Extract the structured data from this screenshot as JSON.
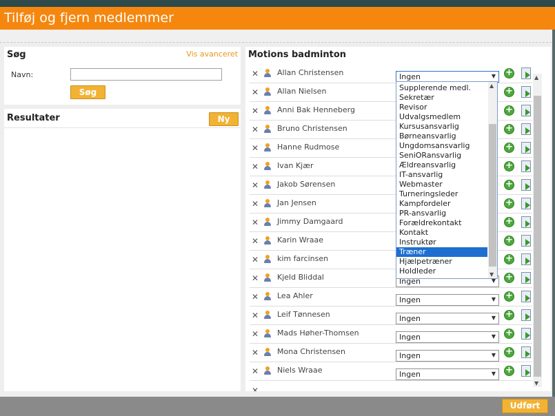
{
  "window": {
    "title": "Tilføj og fjern medlemmer"
  },
  "search": {
    "heading": "Søg",
    "advanced_link": "Vis avanceret",
    "name_label": "Navn:",
    "name_value": "",
    "search_button": "Søg"
  },
  "results": {
    "heading": "Resultater",
    "new_button": "Ny"
  },
  "group": {
    "heading": "Motions badminton"
  },
  "members": [
    {
      "name": "Allan Christensen",
      "role": "Ingen"
    },
    {
      "name": "Allan Nielsen",
      "role": ""
    },
    {
      "name": "Anni Bak Henneberg",
      "role": ""
    },
    {
      "name": "Bruno Christensen",
      "role": ""
    },
    {
      "name": "Hanne Rudmose",
      "role": ""
    },
    {
      "name": "Ivan Kjær",
      "role": ""
    },
    {
      "name": "Jakob Sørensen",
      "role": ""
    },
    {
      "name": "Jan Jensen",
      "role": ""
    },
    {
      "name": "Jimmy Damgaard",
      "role": ""
    },
    {
      "name": "Karin Wraae",
      "role": ""
    },
    {
      "name": "kim farcinsen",
      "role": ""
    },
    {
      "name": "Kjeld Bliddal",
      "role": "Ingen"
    },
    {
      "name": "Lea Ahler",
      "role": "Ingen"
    },
    {
      "name": "Leif Tønnesen",
      "role": "Ingen"
    },
    {
      "name": "Mads Høher-Thomsen",
      "role": "Ingen"
    },
    {
      "name": "Mona Christensen",
      "role": "Ingen"
    },
    {
      "name": "Niels Wraae",
      "role": "Ingen"
    }
  ],
  "role_dropdown": {
    "selected": "Træner",
    "options": [
      "Supplerende medl.",
      "Sekretær",
      "Revisor",
      "Udvalgsmedlem",
      "Kursusansvarlig",
      "Børneansvarlig",
      "Ungdomsansvarlig",
      "SeniORansvarlig",
      "Ældreansvarlig",
      "IT-ansvarlig",
      "Webmaster",
      "Turneringsleder",
      "Kampfordeler",
      "PR-ansvarlig",
      "Forældrekontakt",
      "Kontakt",
      "Instruktør",
      "Træner",
      "Hjælpetræner",
      "Holdleder"
    ]
  },
  "footer": {
    "done_button": "Udført"
  },
  "colors": {
    "accent": "#f5870f",
    "button": "#f2b233",
    "highlight": "#1e6fd0"
  },
  "icons": {
    "remove": "close-icon",
    "person": "person-icon",
    "add": "add-icon",
    "assign": "assign-document-icon"
  }
}
